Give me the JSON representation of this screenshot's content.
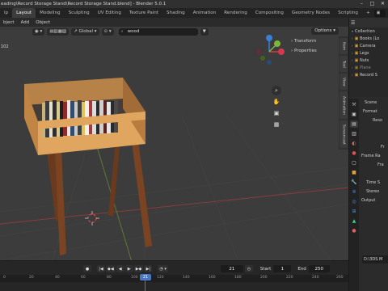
{
  "window": {
    "title": "eading\\Record Storage Stand\\Record Storage Stand.blend] - Blender 5.0.1",
    "controls": [
      "–",
      "□",
      "✕"
    ]
  },
  "workspaces": {
    "menu_fragment": "lp",
    "tabs": [
      "Layout",
      "Modeling",
      "Sculpting",
      "UV Editing",
      "Texture Paint",
      "Shading",
      "Animation",
      "Rendering",
      "Compositing",
      "Geometry Nodes",
      "Scripting"
    ],
    "active": "Layout",
    "add_symbol": "+"
  },
  "viewport": {
    "header_menu": [
      "bject",
      "Add",
      "Object"
    ],
    "orientation": "Global",
    "search": {
      "value": "wood",
      "placeholder": ""
    },
    "options_label": "Options",
    "n_panel": [
      "Transform",
      "Properties"
    ],
    "side_tabs": [
      "Item",
      "Tool",
      "View",
      "Animation",
      "Screencast"
    ],
    "overlay_number": "102"
  },
  "outliner": {
    "items": [
      {
        "label": "Collection",
        "dim": false
      },
      {
        "label": "Books (Lo",
        "dim": false
      },
      {
        "label": "Camera",
        "dim": false
      },
      {
        "label": "Legs",
        "dim": false
      },
      {
        "label": "Nuts",
        "dim": false
      },
      {
        "label": "Plane",
        "dim": true
      },
      {
        "label": "Record S",
        "dim": false
      }
    ]
  },
  "properties": {
    "rows": [
      "Scene",
      "Format",
      "Reso",
      "",
      "",
      "Fr",
      "Frame Ra",
      "Fra",
      "",
      "Time S",
      "Stereo",
      "Output"
    ],
    "output_path": "D:\\3DS M"
  },
  "timeline": {
    "current_frame": "21",
    "start_label": "Start",
    "start": "1",
    "end_label": "End",
    "end": "250",
    "ruler_ticks": [
      "0",
      "20",
      "40",
      "60",
      "80",
      "100",
      "120",
      "140",
      "160",
      "180",
      "200",
      "220",
      "240",
      "260"
    ]
  },
  "colors": {
    "viewport_bg": "#3c3c3c",
    "accent": "#4a78c2",
    "axis_x": "#d6394e",
    "axis_y": "#7fb53a",
    "axis_z": "#3a7fd6",
    "wood": "#c98d4a"
  }
}
